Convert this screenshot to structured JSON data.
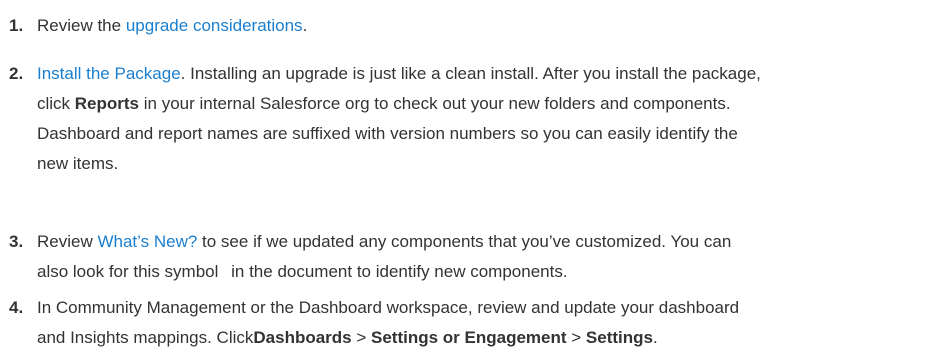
{
  "steps": [
    {
      "number": "1.",
      "pre": "Review the ",
      "link": "upgrade considerations",
      "post": "."
    },
    {
      "number": "2.",
      "link": "Install the Package",
      "text1": ". Installing an upgrade is just like a clean install. After you install the package,",
      "text2": "click ",
      "bold": "Reports",
      "text3": " in your internal Salesforce org to check out your new folders and components.",
      "text4": "Dashboard and report names are suffixed with version numbers so you can easily identify the",
      "text5": "new items."
    },
    {
      "number": "3.",
      "pre": "Review ",
      "link": "What’s New?",
      "text1": " to see if we updated any components that you’ve customized. You can",
      "text2": "also look for this symbol",
      "text3": " in the document to identify new components."
    },
    {
      "number": "4.",
      "text1": "In Community Management or the Dashboard workspace, review and update your dashboard",
      "text2": "and Insights mappings. Click",
      "bold1": "Dashboards",
      "sep1": " > ",
      "bold2": "Settings or Engagement",
      "sep2": "  > ",
      "bold3": "Settings",
      "end": "."
    }
  ]
}
